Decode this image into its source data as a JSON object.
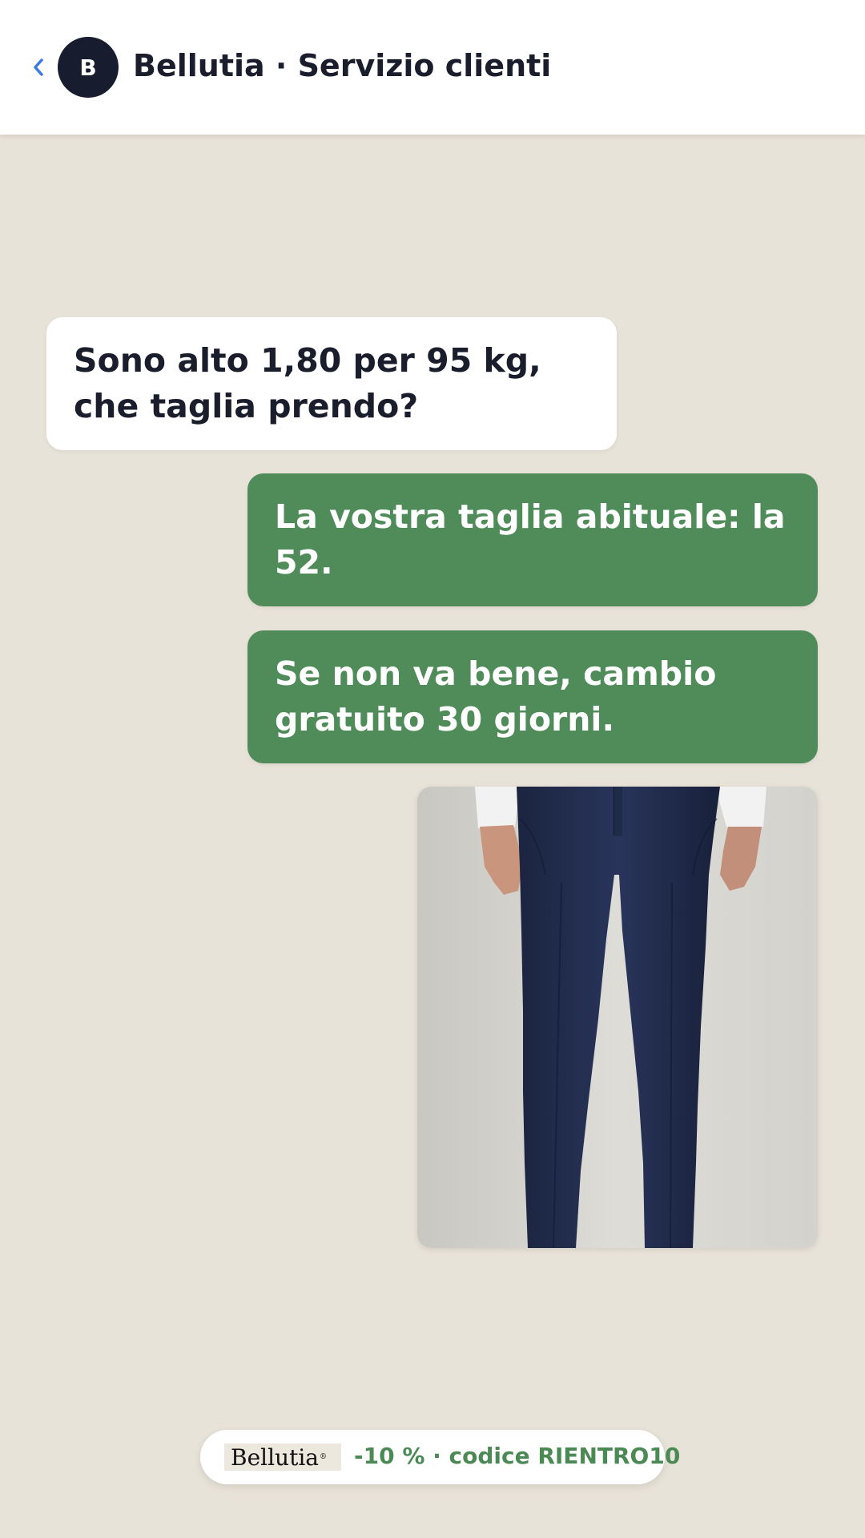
{
  "header": {
    "back_icon": "chevron-left-icon",
    "avatar_letter": "B",
    "title": "Bellutia · Servizio clienti"
  },
  "messages": [
    {
      "from": "customer",
      "text": "Sono alto 1,80 per 95 kg, che taglia prendo?"
    },
    {
      "from": "agent",
      "text": "La vostra taglia abituale: la 52."
    },
    {
      "from": "agent",
      "text": "Se non va bene, cambio gratuito 30 giorni."
    }
  ],
  "product_image": {
    "subject": "navy-trousers"
  },
  "promo": {
    "logo": "Bellutia",
    "logo_mark": "®",
    "text": "-10 % · codice RIENTRO10"
  },
  "colors": {
    "background": "#e8e3d8",
    "agent_bubble": "#508b5a",
    "avatar": "#171c2e",
    "back_icon": "#3b7be0",
    "promo_text": "#4b8a55"
  }
}
